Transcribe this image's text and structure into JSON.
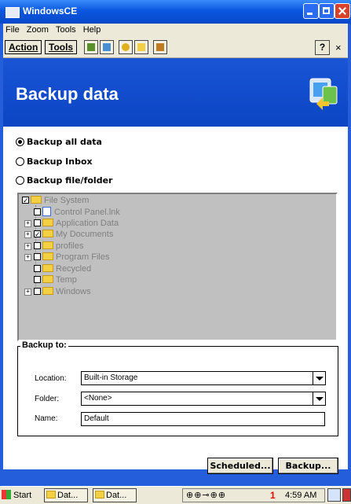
{
  "window": {
    "title": "WindowsCE"
  },
  "menu": [
    "File",
    "Zoom",
    "Tools",
    "Help"
  ],
  "command_bar": {
    "action": "Action",
    "tools": "Tools",
    "help": "?",
    "close": "×"
  },
  "header": {
    "title": "Backup data"
  },
  "options": [
    {
      "label": "Backup all data",
      "selected": true
    },
    {
      "label": "Backup Inbox",
      "selected": false
    },
    {
      "label": "Backup file/folder",
      "selected": false
    }
  ],
  "tree": {
    "root": "File System",
    "items": [
      {
        "label": "Control Panel.lnk",
        "checked": false,
        "expandable": false
      },
      {
        "label": "Application Data",
        "checked": false,
        "expandable": true
      },
      {
        "label": "My Documents",
        "checked": true,
        "expandable": true
      },
      {
        "label": "profiles",
        "checked": false,
        "expandable": true
      },
      {
        "label": "Program Files",
        "checked": false,
        "expandable": true
      },
      {
        "label": "Recycled",
        "checked": false,
        "expandable": false
      },
      {
        "label": "Temp",
        "checked": false,
        "expandable": false
      },
      {
        "label": "Windows",
        "checked": false,
        "expandable": true
      }
    ]
  },
  "backup_to": {
    "legend": "Backup to:",
    "location_label": "Location:",
    "location_value": "Built-in Storage",
    "folder_label": "Folder:",
    "folder_value": "<None>",
    "name_label": "Name:",
    "name_value": "Default"
  },
  "buttons": {
    "scheduled": "Scheduled...",
    "backup": "Backup..."
  },
  "taskbar": {
    "start": "Start",
    "task1": "Dat...",
    "task2": "Dat...",
    "tray_icons": "⊕⊕⊸⊕⊕",
    "tray_count": "1",
    "time": "4:59 AM"
  }
}
